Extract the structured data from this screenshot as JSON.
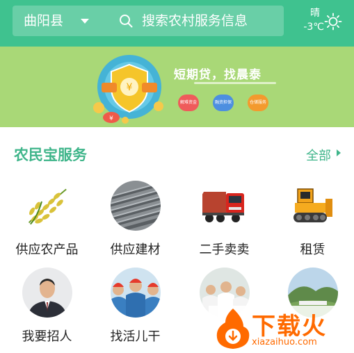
{
  "header": {
    "location": "曲阳县",
    "search_placeholder": "搜索农村服务信息",
    "weather": {
      "condition": "晴",
      "temperature": "-3℃",
      "icon": "sun-icon"
    }
  },
  "banner": {
    "title": "短期贷，找晨泰",
    "pill_1": "解难资金",
    "pill_2": "融资担保",
    "pill_3": "仓储服务"
  },
  "section": {
    "title": "农民宝服务",
    "all_link": "全部"
  },
  "services": [
    {
      "label": "供应农产品",
      "icon": "rice-icon"
    },
    {
      "label": "供应建材",
      "icon": "rebar-icon"
    },
    {
      "label": "二手卖卖",
      "icon": "truck-icon"
    },
    {
      "label": "租赁",
      "icon": "bulldozer-icon"
    },
    {
      "label": "我要招人",
      "icon": "businessman-icon"
    },
    {
      "label": "找活儿干",
      "icon": "workers-icon"
    },
    {
      "label": "找",
      "icon": "doctors-icon"
    },
    {
      "label": "",
      "icon": "landscape-icon"
    }
  ],
  "watermark": {
    "name": "下载火",
    "url": "xiazaihuo.com"
  },
  "colors": {
    "primary": "#3fc28f",
    "banner_bg": "#a9d877",
    "accent": "#3fb58a",
    "watermark": "#ff6a00"
  }
}
